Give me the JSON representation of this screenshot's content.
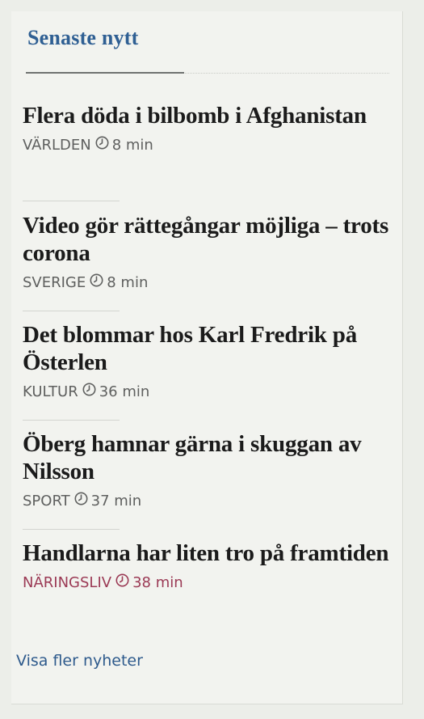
{
  "section": {
    "heading": "Senaste nytt"
  },
  "news": [
    {
      "title": "Flera döda i bilbomb i Afghanistan",
      "category": "VÄRLDEN",
      "time": "8 min",
      "color": "#5f605f"
    },
    {
      "title": "Video gör rättegångar möjliga – trots corona",
      "category": "SVERIGE",
      "time": "8 min",
      "color": "#5f605f"
    },
    {
      "title": "Det blommar hos Karl Fredrik på Österlen",
      "category": "KULTUR",
      "time": "36 min",
      "color": "#5f605f"
    },
    {
      "title": "Öberg hamnar gärna i skuggan av Nilsson",
      "category": "SPORT",
      "time": "37 min",
      "color": "#5f605f"
    },
    {
      "title": "Handlarna har liten tro på framtiden",
      "category": "NÄRINGSLIV",
      "time": "38 min",
      "color": "#9b3a55"
    }
  ],
  "footer": {
    "show_more": "Visa fler nyheter"
  },
  "icons": {
    "clock": "clock-icon"
  }
}
